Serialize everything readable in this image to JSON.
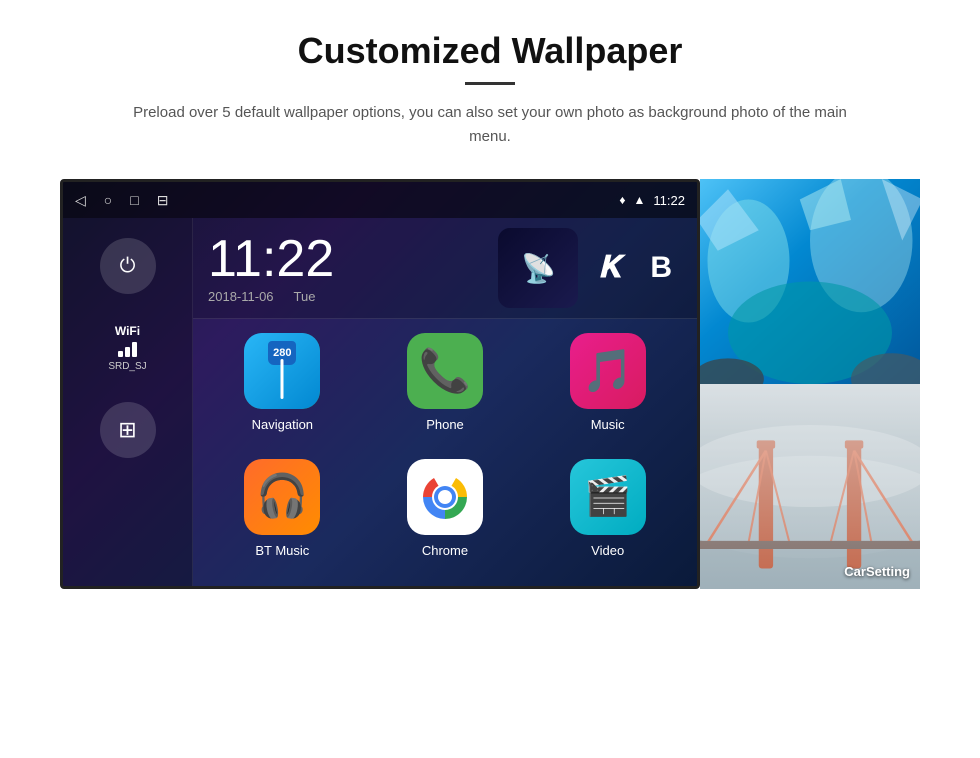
{
  "header": {
    "title": "Customized Wallpaper",
    "subtitle": "Preload over 5 default wallpaper options, you can also set your own photo as background photo of the main menu."
  },
  "statusBar": {
    "time": "11:22",
    "navIcons": [
      "◁",
      "○",
      "□",
      "⊟"
    ],
    "statusIcons": [
      "♦",
      "▲"
    ]
  },
  "clock": {
    "time": "11:22",
    "date": "2018-11-06",
    "day": "Tue"
  },
  "wifi": {
    "label": "WiFi",
    "network": "SRD_SJ"
  },
  "apps": [
    {
      "name": "Navigation",
      "type": "navigation"
    },
    {
      "name": "Phone",
      "type": "phone"
    },
    {
      "name": "Music",
      "type": "music"
    },
    {
      "name": "BT Music",
      "type": "btmusic"
    },
    {
      "name": "Chrome",
      "type": "chrome"
    },
    {
      "name": "Video",
      "type": "video"
    }
  ],
  "wallpapers": [
    {
      "name": "CarSetting",
      "type": "bridge"
    }
  ]
}
